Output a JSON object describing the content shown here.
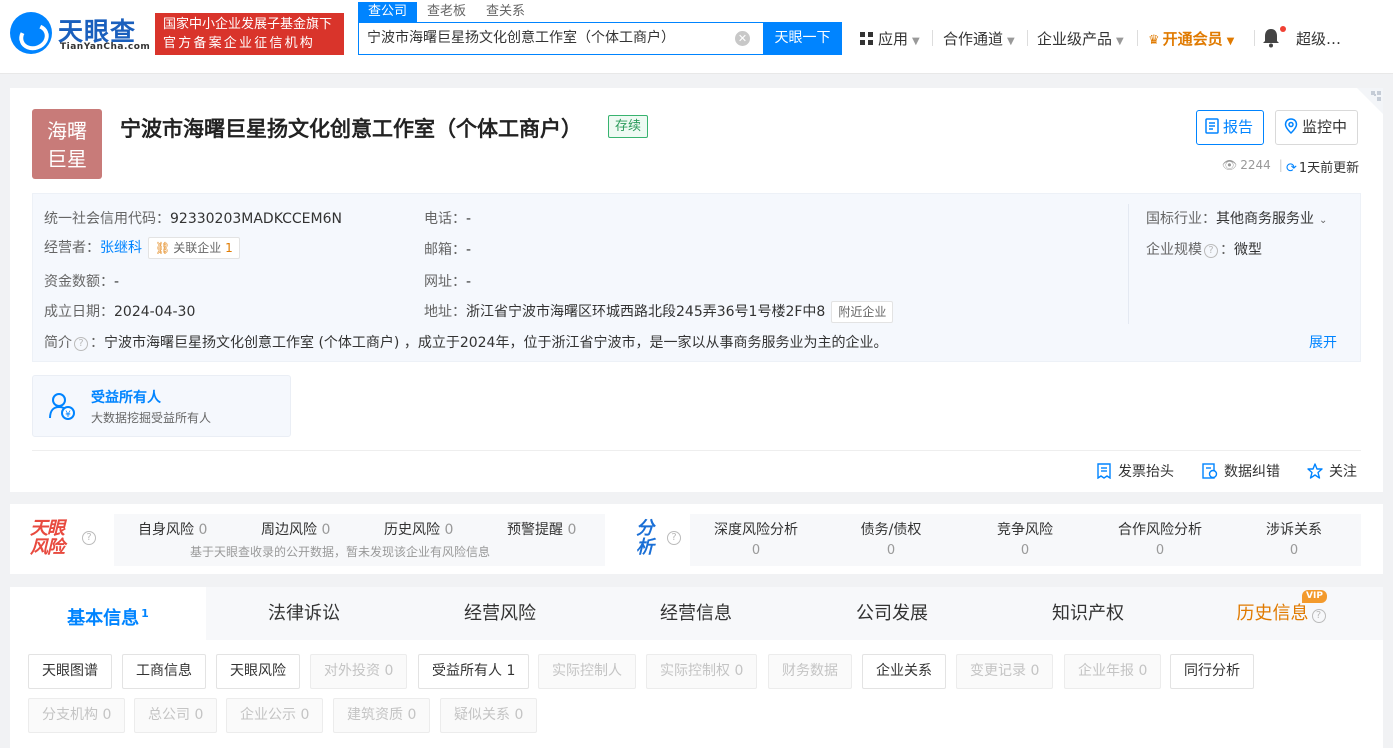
{
  "brand": {
    "logo_text": "天眼查",
    "logo_sub": "TianYanCha.com",
    "slogan_line1": "国家中小企业发展子基金旗下",
    "slogan_line2": "官方备案企业征信机构",
    "brand_red": "#d9342b",
    "accent": "#0084ff"
  },
  "search": {
    "tabs": [
      {
        "label": "查公司",
        "active": true
      },
      {
        "label": "查老板",
        "active": false
      },
      {
        "label": "查关系",
        "active": false
      }
    ],
    "query": "宁波市海曙巨星扬文化创意工作室（个体工商户）",
    "button": "天眼一下"
  },
  "nav": {
    "apps": "应用",
    "channel": "合作通道",
    "enterprise": "企业级产品",
    "vip": "开通会员",
    "user": "超级…"
  },
  "company": {
    "avatar_line1": "海曙",
    "avatar_line2": "巨星",
    "name": "宁波市海曙巨星扬文化创意工作室（个体工商户）",
    "status": "存续",
    "report_btn": "报告",
    "monitor_btn": "监控中",
    "views": "2244",
    "updated": "1天前更新"
  },
  "info": {
    "credit_code_label": "统一社会信用代码：",
    "credit_code": "92330203MADKCCEM6N",
    "operator_label": "经营者：",
    "operator": "张继科",
    "related_label": "关联企业",
    "related_count": "1",
    "capital_label": "资金数额：",
    "capital": "-",
    "founded_label": "成立日期：",
    "founded": "2024-04-30",
    "phone_label": "电话：",
    "phone": "-",
    "email_label": "邮箱：",
    "email": "-",
    "website_label": "网址：",
    "website": "-",
    "address_label": "地址：",
    "address": "浙江省宁波市海曙区环城西路北段245弄36号1号楼2F中8",
    "nearby_btn": "附近企业",
    "industry_label": "国标行业：",
    "industry": "其他商务服务业",
    "scale_label": "企业规模",
    "scale": "微型",
    "intro_label": "简介",
    "intro": "宁波市海曙巨星扬文化创意工作室 (个体工商户) ，成立于2024年，位于浙江省宁波市，是一家以从事商务服务业为主的企业。",
    "expand": "展开"
  },
  "beneficiary": {
    "title": "受益所有人",
    "subtitle": "大数据挖掘受益所有人"
  },
  "actions": {
    "invoice": "发票抬头",
    "correct": "数据纠错",
    "follow": "关注"
  },
  "risk": {
    "logo_line1": "天眼",
    "logo_line2": "风险",
    "items": [
      {
        "label": "自身风险",
        "count": "0"
      },
      {
        "label": "周边风险",
        "count": "0"
      },
      {
        "label": "历史风险",
        "count": "0"
      },
      {
        "label": "预警提醒",
        "count": "0"
      }
    ],
    "note": "基于天眼查收录的公开数据，暂未发现该企业有风险信息"
  },
  "analysis": {
    "logo_line1": "分",
    "logo_line2": "析",
    "items": [
      {
        "label": "深度风险分析",
        "count": "0"
      },
      {
        "label": "债务/债权",
        "count": "0"
      },
      {
        "label": "竞争风险",
        "count": "0"
      },
      {
        "label": "合作风险分析",
        "count": "0"
      },
      {
        "label": "涉诉关系",
        "count": "0"
      }
    ]
  },
  "tabs": [
    {
      "label": "基本信息",
      "sup": "1"
    },
    {
      "label": "法律诉讼",
      "sup": ""
    },
    {
      "label": "经营风险",
      "sup": ""
    },
    {
      "label": "经营信息",
      "sup": ""
    },
    {
      "label": "公司发展",
      "sup": ""
    },
    {
      "label": "知识产权",
      "sup": ""
    },
    {
      "label": "历史信息",
      "sup": ""
    }
  ],
  "vip_badge": "VIP",
  "chips_row1": [
    {
      "label": "天眼图谱",
      "disabled": false
    },
    {
      "label": "工商信息",
      "disabled": false
    },
    {
      "label": "天眼风险",
      "disabled": false
    },
    {
      "label": "对外投资 0",
      "disabled": true
    },
    {
      "label": "受益所有人 1",
      "disabled": false
    },
    {
      "label": "实际控制人",
      "disabled": true
    },
    {
      "label": "实际控制权 0",
      "disabled": true
    },
    {
      "label": "财务数据",
      "disabled": true
    },
    {
      "label": "企业关系",
      "disabled": false
    },
    {
      "label": "变更记录 0",
      "disabled": true
    },
    {
      "label": "企业年报 0",
      "disabled": true
    },
    {
      "label": "同行分析",
      "disabled": false
    }
  ],
  "chips_row2": [
    {
      "label": "分支机构 0",
      "disabled": true
    },
    {
      "label": "总公司 0",
      "disabled": true
    },
    {
      "label": "企业公示 0",
      "disabled": true
    },
    {
      "label": "建筑资质 0",
      "disabled": true
    },
    {
      "label": "疑似关系 0",
      "disabled": true
    }
  ]
}
